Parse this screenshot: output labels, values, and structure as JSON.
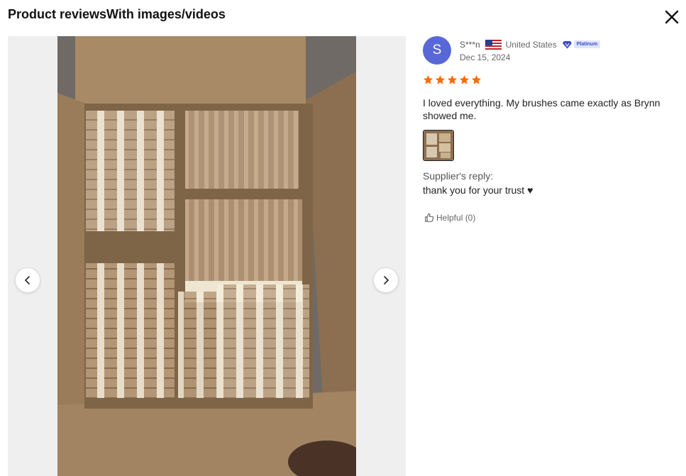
{
  "header": {
    "title": "Product reviewsWith images/videos",
    "close_icon": "close-icon"
  },
  "gallery": {
    "prev_icon": "chevron-left-icon",
    "next_icon": "chevron-right-icon",
    "image_description": "Open cardboard box filled with bagged makeup brushes labeled CHOCOGLAZE"
  },
  "review": {
    "avatar_letter": "S",
    "username": "S***n",
    "country": "United States",
    "badge": "Platinum",
    "date": "Dec 15, 2024",
    "rating": 5,
    "text": "I loved everything. My brushes came exactly as Brynn showed me.",
    "supplier_reply_label": "Supplier's reply:",
    "supplier_reply": "thank you for your trust ♥",
    "helpful_label": "Helpful (0)"
  },
  "colors": {
    "avatar": "#5868d6",
    "star": "#ff6a00",
    "badge_bg": "#dfe4ff",
    "badge_text": "#3a4ec2"
  }
}
